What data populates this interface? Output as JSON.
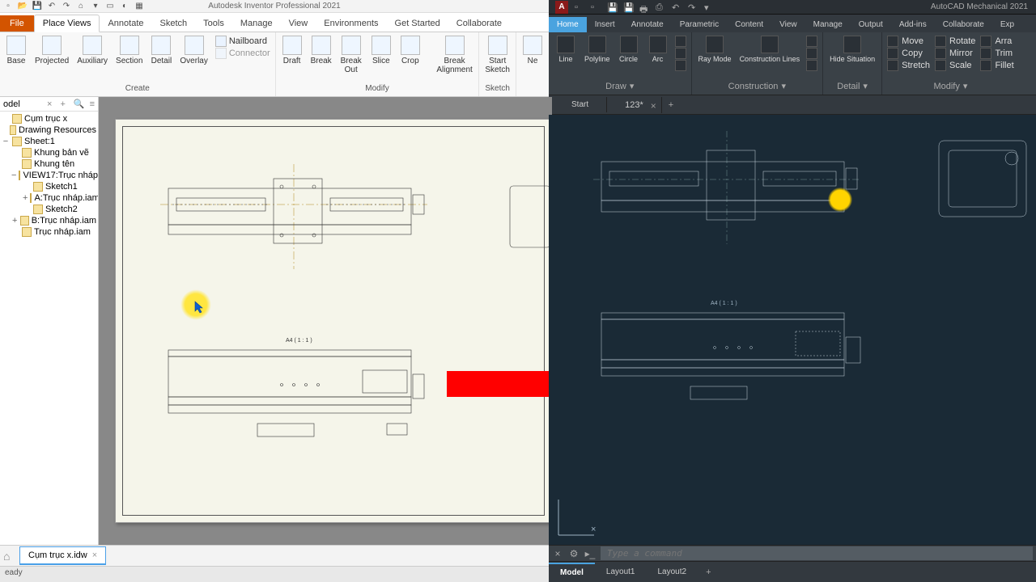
{
  "left": {
    "title": "Autodesk Inventor Professional 2021",
    "qat_icons": [
      "new",
      "open",
      "save",
      "sep",
      "undo",
      "redo",
      "sep",
      "home",
      "dd",
      "select",
      "appearance",
      "material",
      "sep"
    ],
    "file_label": "File",
    "tabs": [
      "Place Views",
      "Annotate",
      "Sketch",
      "Tools",
      "Manage",
      "View",
      "Environments",
      "Get Started",
      "Collaborate"
    ],
    "active_tab": 0,
    "ribbon": {
      "create": {
        "label": "Create",
        "btns": [
          "Base",
          "Projected",
          "Auxiliary",
          "Section",
          "Detail",
          "Overlay"
        ],
        "side": {
          "nailboard": "Nailboard",
          "connector": "Connector"
        }
      },
      "modify": {
        "label": "Modify",
        "btns": [
          "Draft",
          "Break",
          "Break Out",
          "Slice",
          "Crop",
          "",
          "Break Alignment"
        ]
      },
      "sketch": {
        "label": "Sketch",
        "btns": [
          "Start Sketch"
        ]
      },
      "ne": "Ne"
    },
    "browser": {
      "header": "odel",
      "items": [
        {
          "lvl": 0,
          "tw": "",
          "ic": "asm",
          "label": "Cụm trục x"
        },
        {
          "lvl": 0,
          "tw": "",
          "ic": "fold",
          "label": "Drawing Resources"
        },
        {
          "lvl": 0,
          "tw": "−",
          "ic": "sheet",
          "label": "Sheet:1"
        },
        {
          "lvl": 1,
          "tw": "",
          "ic": "sk",
          "label": "Khung bản vẽ"
        },
        {
          "lvl": 1,
          "tw": "",
          "ic": "sk",
          "label": "Khung tên"
        },
        {
          "lvl": 1,
          "tw": "−",
          "ic": "view",
          "label": "VIEW17:Trục nháp."
        },
        {
          "lvl": 2,
          "tw": "",
          "ic": "sk",
          "label": "Sketch1"
        },
        {
          "lvl": 2,
          "tw": "+",
          "ic": "view",
          "label": "A:Trục nháp.iam"
        },
        {
          "lvl": 2,
          "tw": "",
          "ic": "sk",
          "label": "Sketch2"
        },
        {
          "lvl": 1,
          "tw": "+",
          "ic": "view",
          "label": "B:Trục nháp.iam"
        },
        {
          "lvl": 1,
          "tw": "",
          "ic": "asm",
          "label": "Trục nháp.iam"
        }
      ]
    },
    "sheet_scale": "A4 ( 1 : 1 )",
    "doc_tab": "Cụm trục x.idw",
    "status": "eady"
  },
  "right": {
    "title": "AutoCAD Mechanical 2021",
    "logo": "A",
    "qat_icons": [
      "new",
      "open",
      "save",
      "saveas",
      "plot",
      "publish",
      "undo",
      "redo",
      "dd"
    ],
    "tabs": [
      "Home",
      "Insert",
      "Annotate",
      "Parametric",
      "Content",
      "View",
      "Manage",
      "Output",
      "Add-ins",
      "Collaborate",
      "Exp"
    ],
    "active_tab": 0,
    "ribbon": {
      "draw": {
        "label": "Draw",
        "btns": [
          "Line",
          "Polyline",
          "Circle",
          "Arc"
        ]
      },
      "construction": {
        "label": "Construction",
        "btns": [
          "Ray Mode",
          "Construction Lines"
        ]
      },
      "detail": {
        "label": "Detail",
        "btns": [
          "Hide Situation"
        ]
      },
      "modify": {
        "label": "Modify",
        "rows": [
          [
            "Move",
            "Rotate",
            "Arra"
          ],
          [
            "Copy",
            "Mirror",
            "Trim"
          ],
          [
            "Stretch",
            "Scale",
            "Fillet"
          ]
        ]
      }
    },
    "file_tabs": [
      "Start",
      "123*"
    ],
    "scale_top": "A4 ( 1 : 1 )",
    "scale_bot": "A4 ( 1 : 1 )",
    "cmd_placeholder": "Type a command",
    "model_tabs": [
      "Model",
      "Layout1",
      "Layout2"
    ]
  }
}
